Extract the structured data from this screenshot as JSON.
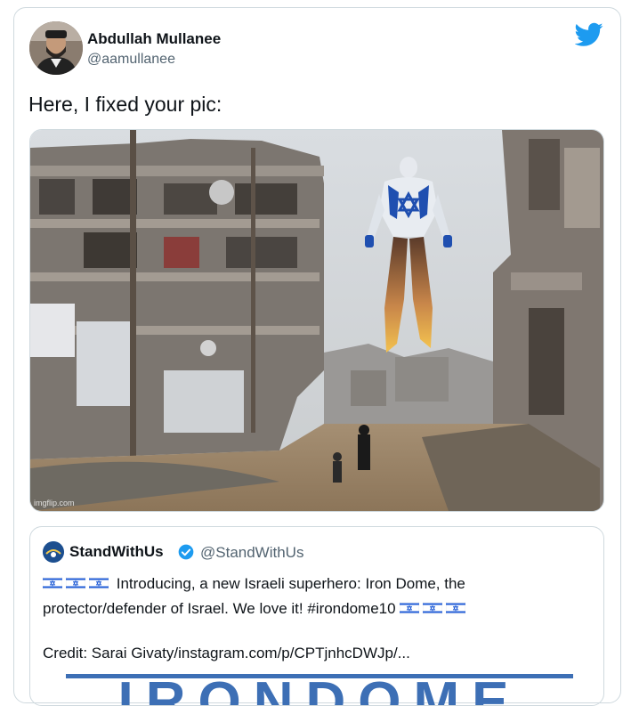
{
  "tweet": {
    "author_name": "Abdullah Mullanee",
    "author_handle": "@aamullanee",
    "text": "Here, I fixed your pic:",
    "media_watermark": "imgflip.com"
  },
  "quoted": {
    "author_name": "StandWithUs",
    "author_handle": "@StandWithUs",
    "line1": "Introducing, a new Israeli superhero: Iron Dome, the",
    "line2": "protector/defender of Israel. We love it! #irondome10",
    "credit": "Credit: Sarai Givaty/instagram.com/p/CPTjnhcDWJp/...",
    "banner_text": "IRONDOME"
  },
  "icons": {
    "brand": "twitter-bird-icon",
    "verified": "verified-badge-icon",
    "flag": "israel-flag-icon"
  },
  "colors": {
    "twitter_blue": "#1d9bf0",
    "verified_blue": "#1d9bf0",
    "border": "#cfd9de",
    "secondary_text": "#536471"
  }
}
